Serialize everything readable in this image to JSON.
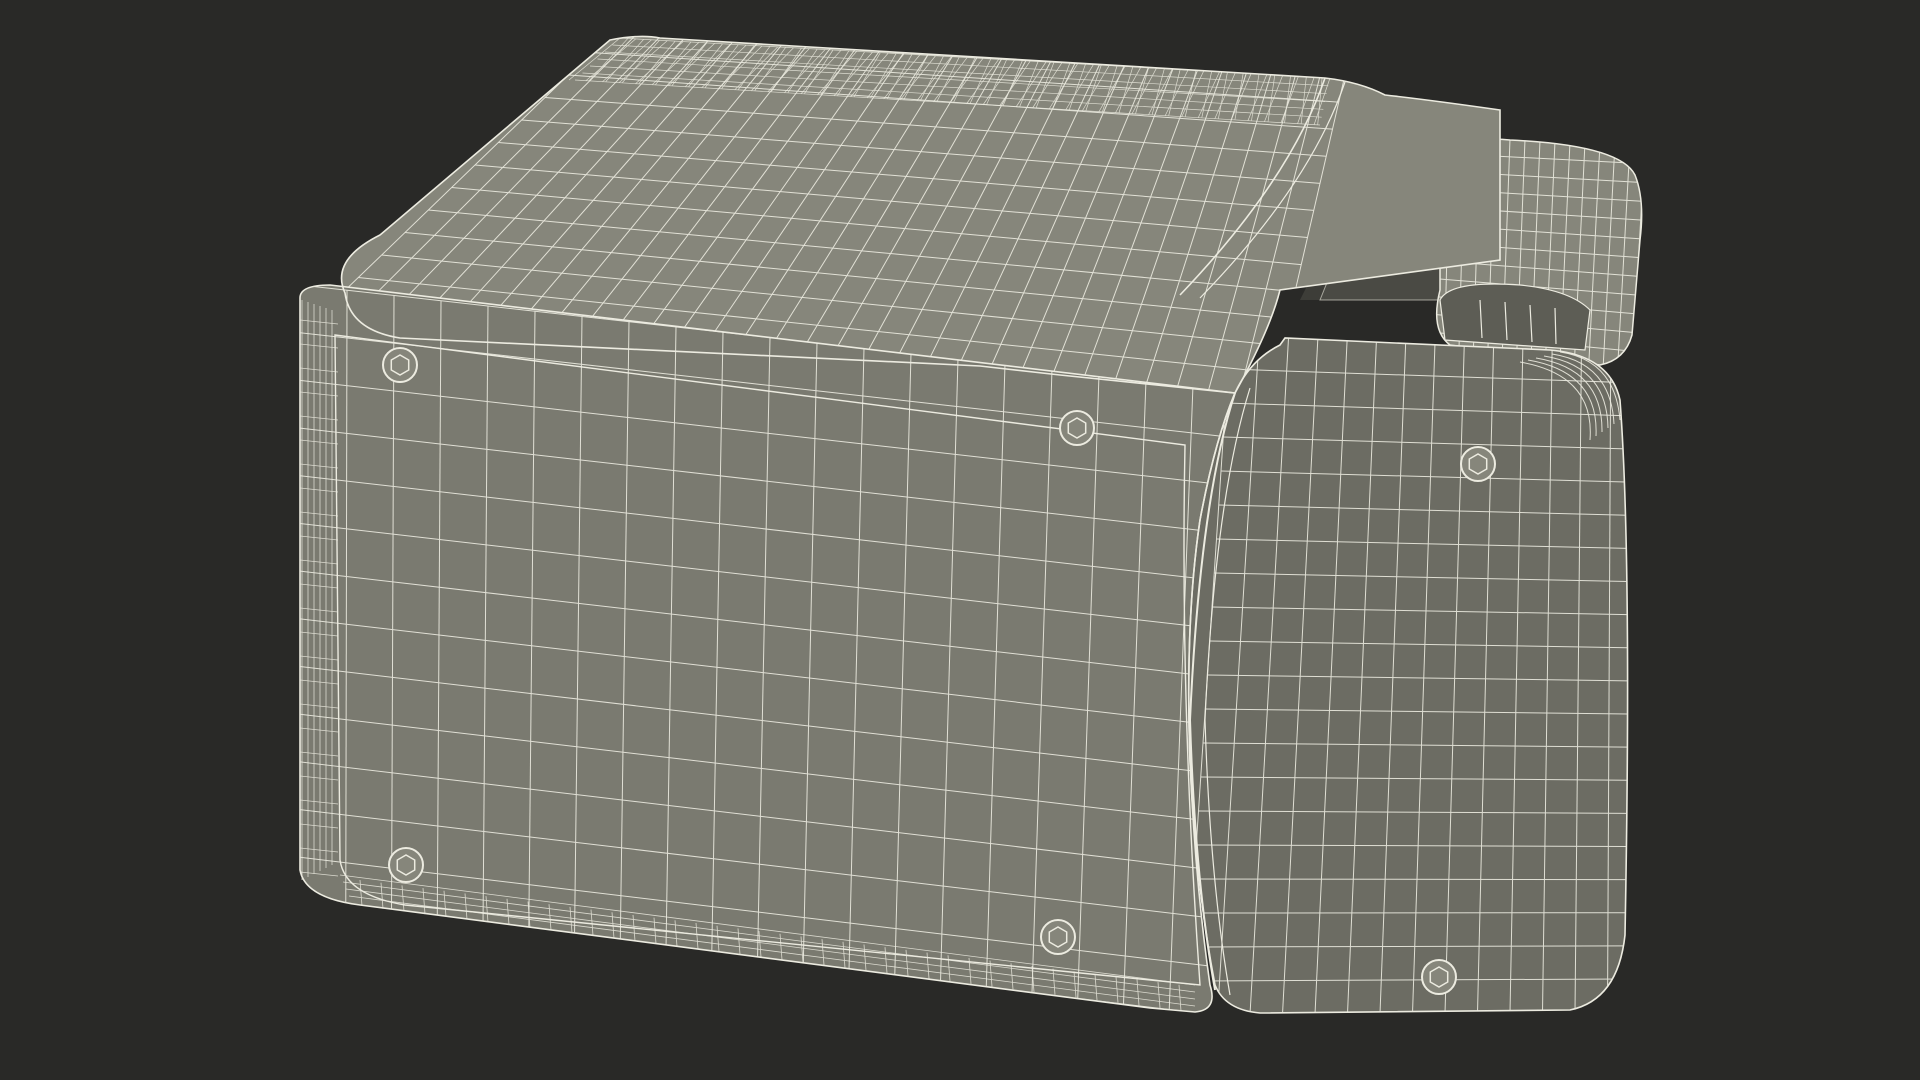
{
  "scene": {
    "subject": "wireframe-3d-model",
    "colors": {
      "background": "#292927",
      "surface": "#7a7a70",
      "surface_dark": "#6c6c63",
      "surface_light": "#86867b",
      "wire": "#ecebe0",
      "cavity": "#3d3d38"
    }
  }
}
